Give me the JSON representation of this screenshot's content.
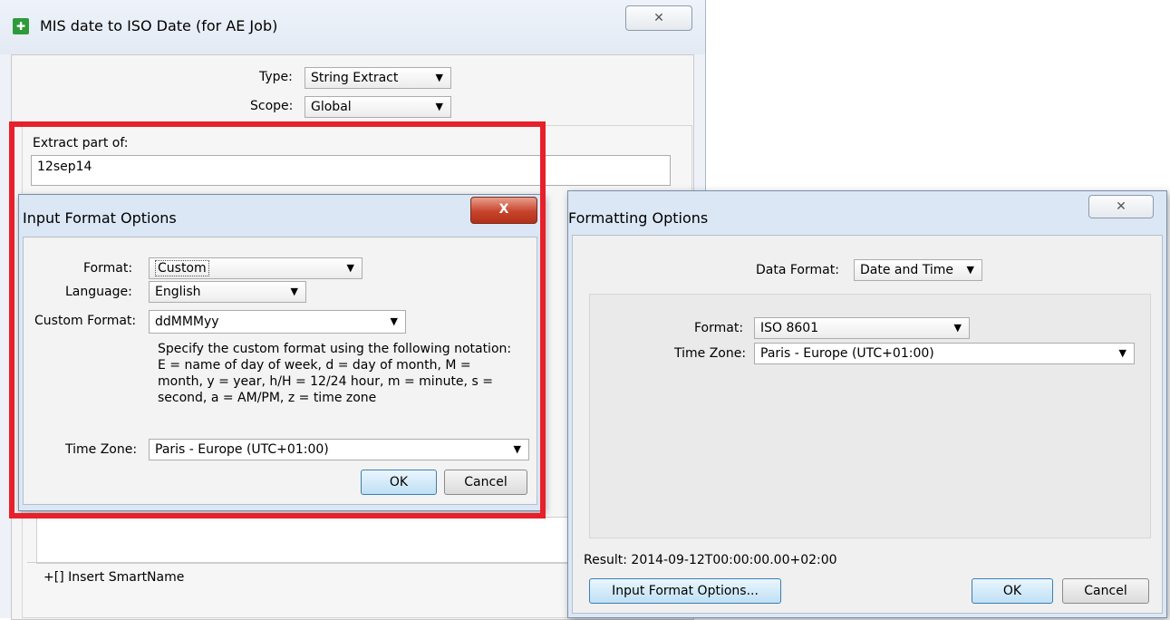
{
  "main_window": {
    "title": "MIS date to ISO Date (for AE Job)",
    "close_glyph": "✕",
    "type_label": "Type:",
    "type_value": "String Extract",
    "scope_label": "Scope:",
    "scope_value": "Global",
    "extract_label": "Extract part of:",
    "extract_value": "12sep14",
    "insert_smartname": "+[] Insert SmartName",
    "app_icon": "smartnames-icon"
  },
  "input_format_dialog": {
    "title": "Input Format Options",
    "close_glyph": "X",
    "format_label": "Format:",
    "format_value": "Custom",
    "language_label": "Language:",
    "language_value": "English",
    "custom_format_label": "Custom Format:",
    "custom_format_value": "ddMMMyy",
    "notation_help": [
      "Specify the custom format using the following notation:",
      "E = name of day of week, d = day of month, M =",
      "month, y = year, h/H = 12/24 hour, m = minute, s =",
      "second, a = AM/PM, z = time zone"
    ],
    "timezone_label": "Time Zone:",
    "timezone_value": "Paris - Europe (UTC+01:00)",
    "ok": "OK",
    "cancel": "Cancel"
  },
  "formatting_dialog": {
    "title": "Formatting Options",
    "close_glyph": "✕",
    "data_format_label": "Data Format:",
    "data_format_value": "Date and Time",
    "format_label": "Format:",
    "format_value": "ISO 8601",
    "timezone_label": "Time Zone:",
    "timezone_value": "Paris - Europe (UTC+01:00)",
    "result_text": "Result: 2014-09-12T00:00:00.00+02:00",
    "input_format_button": "Input Format Options...",
    "ok": "OK",
    "cancel": "Cancel"
  },
  "colors": {
    "highlight_frame": "#e8202b",
    "title_bar": "#dbe7f5",
    "default_button": "#bfe0f5"
  }
}
